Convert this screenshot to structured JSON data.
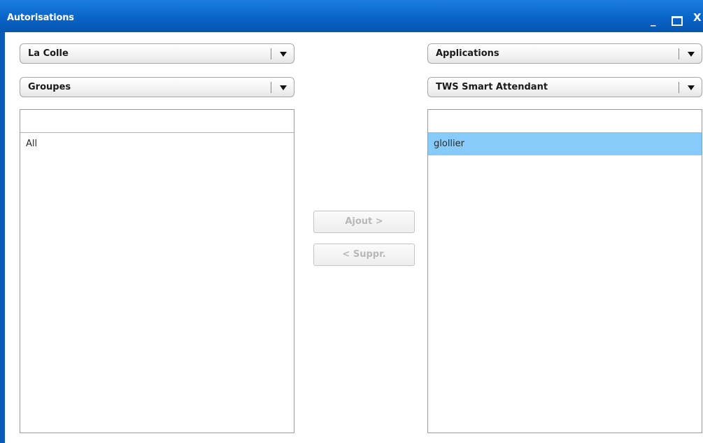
{
  "window": {
    "title": "Autorisations",
    "controls": {
      "minimize": "_",
      "close": "X"
    }
  },
  "left": {
    "site_select": {
      "value": "La Colle"
    },
    "type_select": {
      "value": "Groupes"
    },
    "list": {
      "items": [
        "All"
      ]
    }
  },
  "right": {
    "category_select": {
      "value": "Applications"
    },
    "app_select": {
      "value": "TWS Smart Attendant"
    },
    "list": {
      "items": [
        "glollier"
      ],
      "selected_index": 0
    }
  },
  "actions": {
    "add_label": "Ajout >",
    "remove_label": "< Suppr.",
    "disabled": true
  },
  "colors": {
    "titlebar": "#0a64c8",
    "selection": "#87cbfa",
    "disabled_text": "#b8b8b8"
  }
}
